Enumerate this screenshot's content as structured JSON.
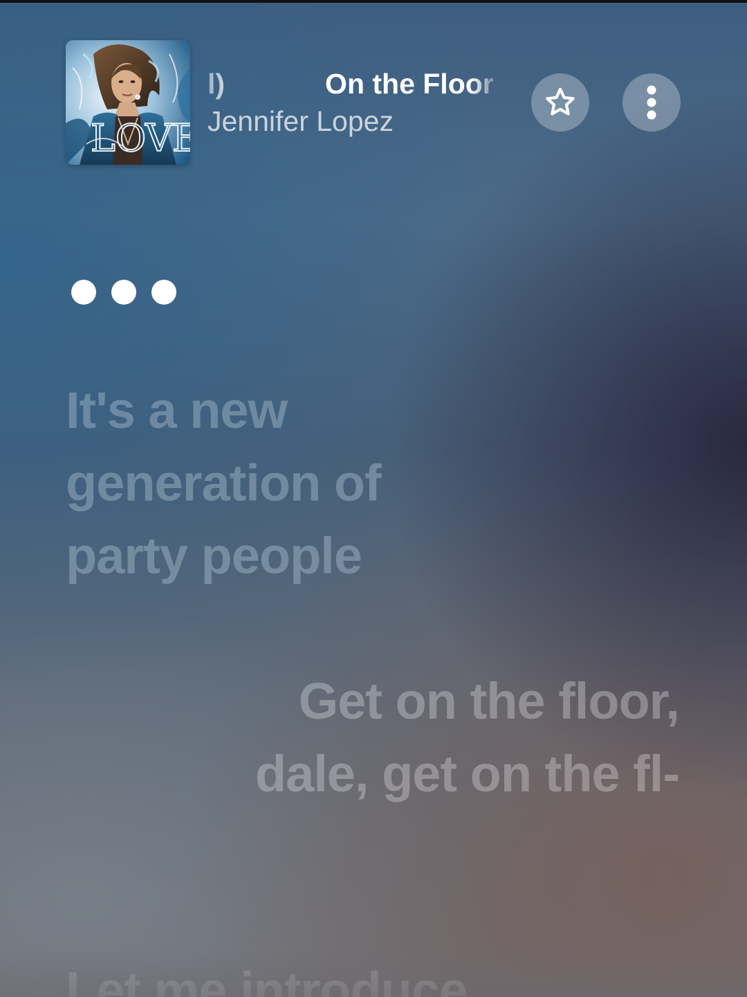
{
  "now_playing": {
    "title_tail": "l)",
    "title": "On the Floor",
    "artist": "Jennifer Lopez",
    "album_art": "album-cover"
  },
  "actions": {
    "favorite_icon": "star-outline-icon",
    "more_icon": "vertical-ellipsis-icon"
  },
  "lyrics": {
    "lines": [
      "It's a new generation of party people",
      "Get on the floor, dale, get on the fl-",
      "Let me introduce"
    ]
  },
  "colors": {
    "text_primary": "#ffffff",
    "button_background": "rgba(255,255,255,0.28)"
  }
}
